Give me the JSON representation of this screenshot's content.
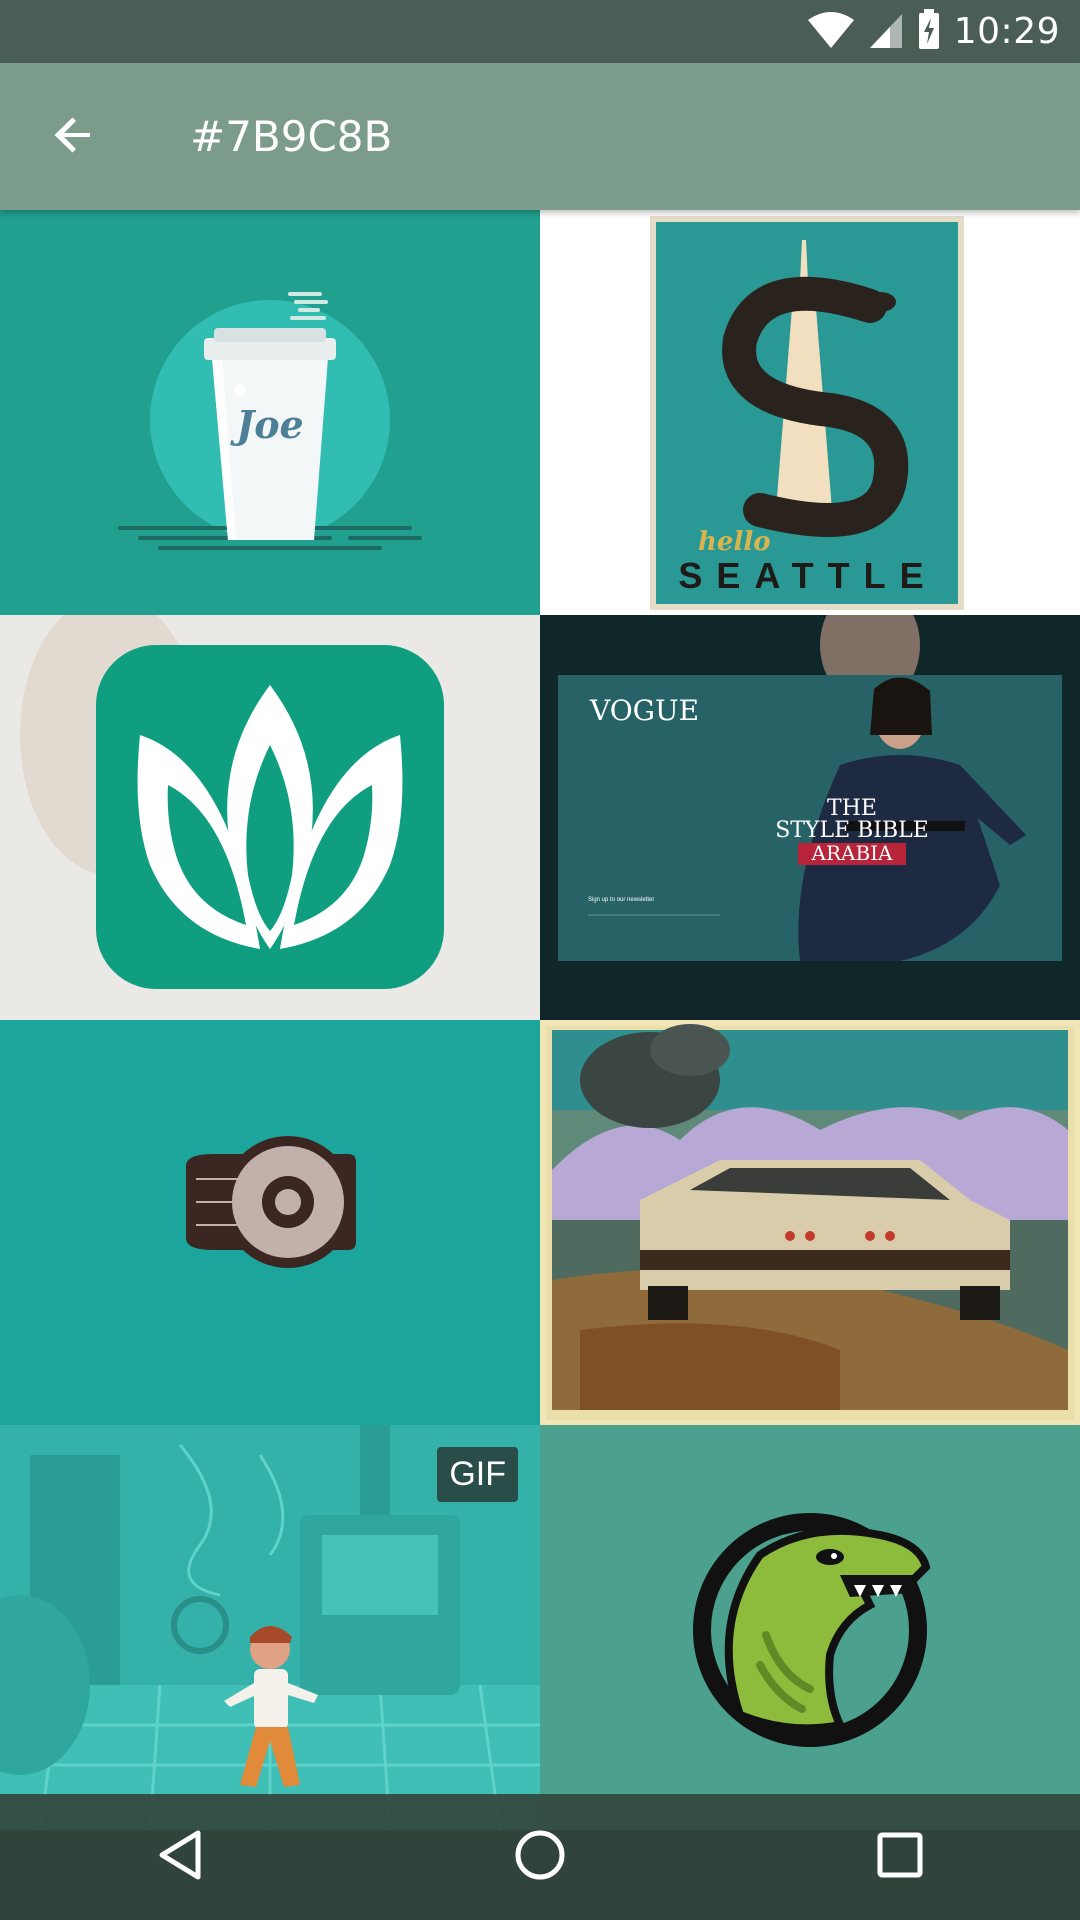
{
  "status_bar": {
    "time": "10:29",
    "icons": [
      "wifi-icon",
      "cellular-signal-icon",
      "battery-charging-icon"
    ]
  },
  "toolbar": {
    "title": "#7B9C8B",
    "back_icon": "arrow-left-icon",
    "background_color": "#7B9C8B"
  },
  "grid": {
    "tiles": [
      {
        "name": "coffee-cup-joe",
        "cup_text": "Joe"
      },
      {
        "name": "hello-seattle-poster",
        "script_text": "hello",
        "title": "SEATTLE"
      },
      {
        "name": "lotus-app-icon"
      },
      {
        "name": "vogue-arabia-website",
        "brand": "VOGUE",
        "headline_lines": [
          "THE",
          "STYLE BIBLE",
          "ARABIA"
        ],
        "newsletter": "Sign up to our newsletter"
      },
      {
        "name": "speed-disc-logo"
      },
      {
        "name": "vintage-car-collage"
      },
      {
        "name": "animated-lab-scene",
        "badge": "GIF"
      },
      {
        "name": "t-rex-badge"
      }
    ]
  },
  "navbar": {
    "buttons": [
      "back-triangle-icon",
      "home-circle-icon",
      "recents-square-icon"
    ]
  }
}
